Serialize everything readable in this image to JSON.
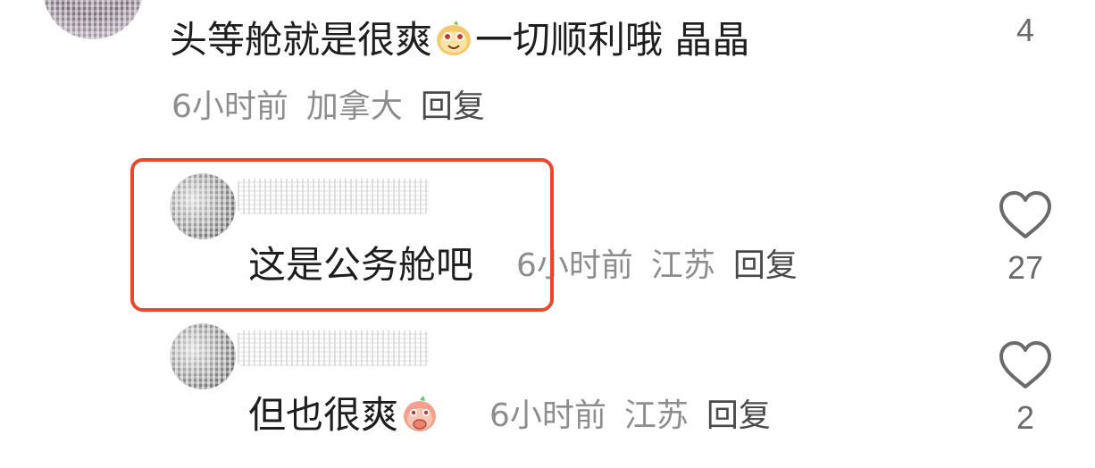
{
  "comments": [
    {
      "text_before_emoji": "头等舱就是很爽",
      "emoji": "grinning-dog-emoji",
      "text_after_emoji": "一切顺利哦 晶晶",
      "time": "6小时前",
      "location": "加拿大",
      "reply_label": "回复",
      "like_count": "4"
    },
    {
      "text": "这是公务舱吧",
      "time": "6小时前",
      "location": "江苏",
      "reply_label": "回复",
      "like_count": "27"
    },
    {
      "text": "但也很爽",
      "emoji": "covering-mouth-peach-emoji",
      "time": "6小时前",
      "location": "江苏",
      "reply_label": "回复",
      "like_count": "2"
    }
  ],
  "colors": {
    "highlight_border": "#e8472e",
    "meta_text": "#8d8d8d",
    "reply_text": "#4a4a4a",
    "body_text": "#1e1e1e"
  }
}
